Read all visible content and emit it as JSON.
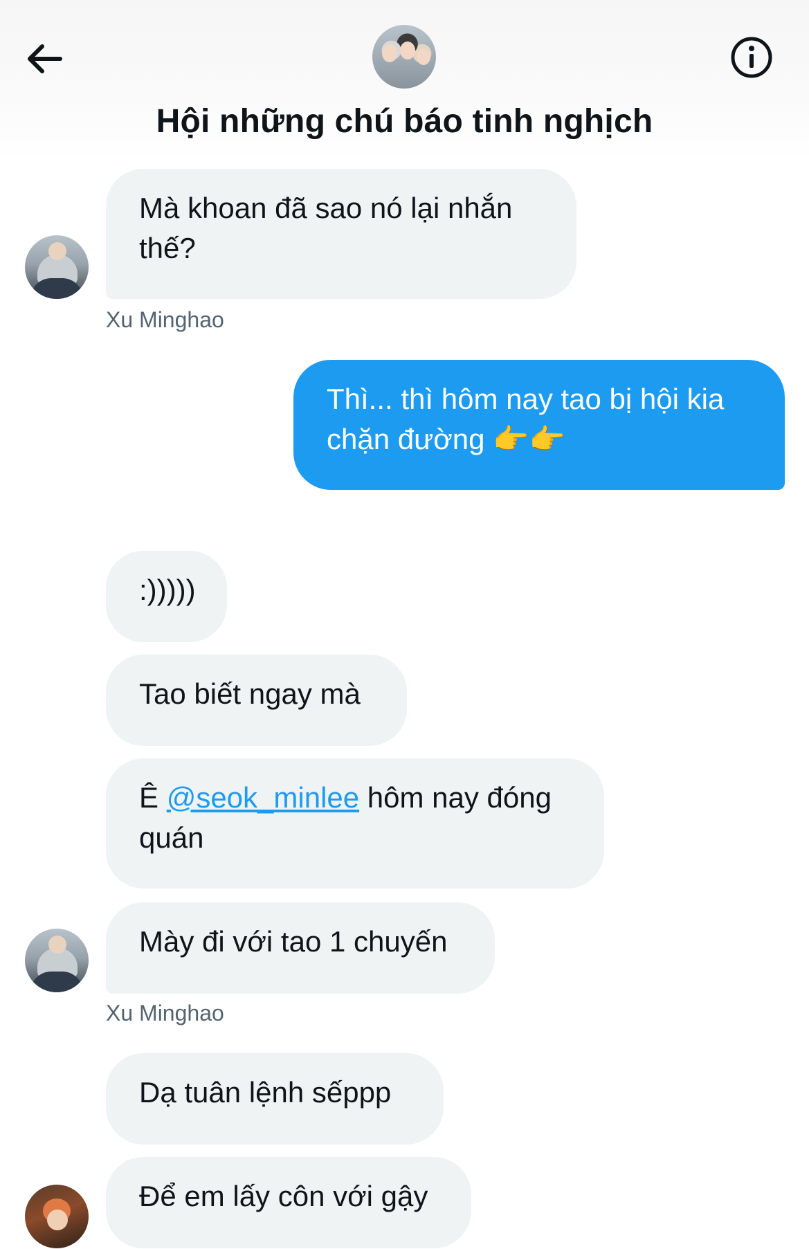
{
  "header": {
    "title": "Hội những chú báo tinh nghịch",
    "back_icon": "arrow-left-icon",
    "info_icon": "info-circle-icon"
  },
  "messages": [
    {
      "side": "in",
      "text": "Mà khoan đã sao nó lại nhắn",
      "text2": "thế?",
      "sender": "Xu Minghao"
    },
    {
      "side": "out",
      "text": "Thì... thì hôm nay tao bị hội kia",
      "text2": "chặn đường",
      "emoji": "👉👉"
    },
    {
      "side": "in",
      "text": ":)))))"
    },
    {
      "side": "in",
      "text": "Tao biết ngay mà"
    },
    {
      "side": "in",
      "prefix": "Ê",
      "mention": "@seok_minlee",
      "text": "hôm nay đóng",
      "text2": "quán"
    },
    {
      "side": "in",
      "text": "Mày đi với tao 1 chuyến",
      "sender": "Xu Minghao"
    },
    {
      "side": "in",
      "text": "Dạ tuân lệnh sếppp"
    },
    {
      "side": "in",
      "text": "Để em lấy côn với gậy"
    }
  ],
  "colors": {
    "outgoing_bubble": "#1d9bf0",
    "incoming_bubble": "#eff3f4",
    "sender_name": "#536471",
    "mention": "#1d9bf0"
  }
}
